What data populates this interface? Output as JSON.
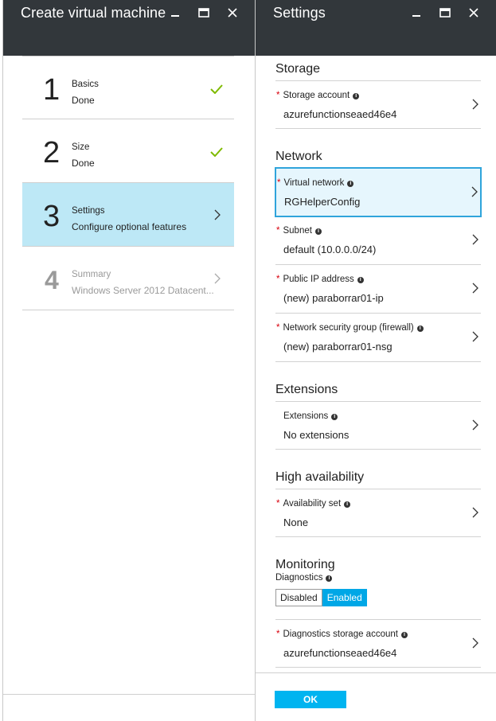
{
  "left_blade": {
    "title": "Create virtual machine",
    "steps": [
      {
        "number": "1",
        "title": "Basics",
        "subtitle": "Done",
        "status": "done"
      },
      {
        "number": "2",
        "title": "Size",
        "subtitle": "Done",
        "status": "done"
      },
      {
        "number": "3",
        "title": "Settings",
        "subtitle": "Configure optional features",
        "status": "active"
      },
      {
        "number": "4",
        "title": "Summary",
        "subtitle": "Windows Server 2012 Datacent...",
        "status": "disabled"
      }
    ]
  },
  "right_blade": {
    "title": "Settings",
    "sections": {
      "storage": {
        "title": "Storage",
        "storage_account_label": "Storage account",
        "storage_account_value": "azurefunctionseaed46e4"
      },
      "network": {
        "title": "Network",
        "virtual_network_label": "Virtual network",
        "virtual_network_value": "RGHelperConfig",
        "subnet_label": "Subnet",
        "subnet_value": "default (10.0.0.0/24)",
        "public_ip_label": "Public IP address",
        "public_ip_value": "(new) paraborrar01-ip",
        "nsg_label": "Network security group (firewall)",
        "nsg_value": "(new) paraborrar01-nsg"
      },
      "extensions": {
        "title": "Extensions",
        "extensions_label": "Extensions",
        "extensions_value": "No extensions"
      },
      "high_availability": {
        "title": "High availability",
        "availability_set_label": "Availability set",
        "availability_set_value": "None"
      },
      "monitoring": {
        "title": "Monitoring",
        "diagnostics_label": "Diagnostics",
        "disabled_label": "Disabled",
        "enabled_label": "Enabled",
        "selected": "Enabled",
        "diag_storage_label": "Diagnostics storage account",
        "diag_storage_value": "azurefunctionseaed46e4"
      }
    },
    "ok_label": "OK"
  },
  "colors": {
    "header_bg": "#32373b",
    "active_step_bg": "#bde8f6",
    "accent": "#00a7e6",
    "check_green": "#7fba00",
    "required_red": "#d9000d"
  }
}
